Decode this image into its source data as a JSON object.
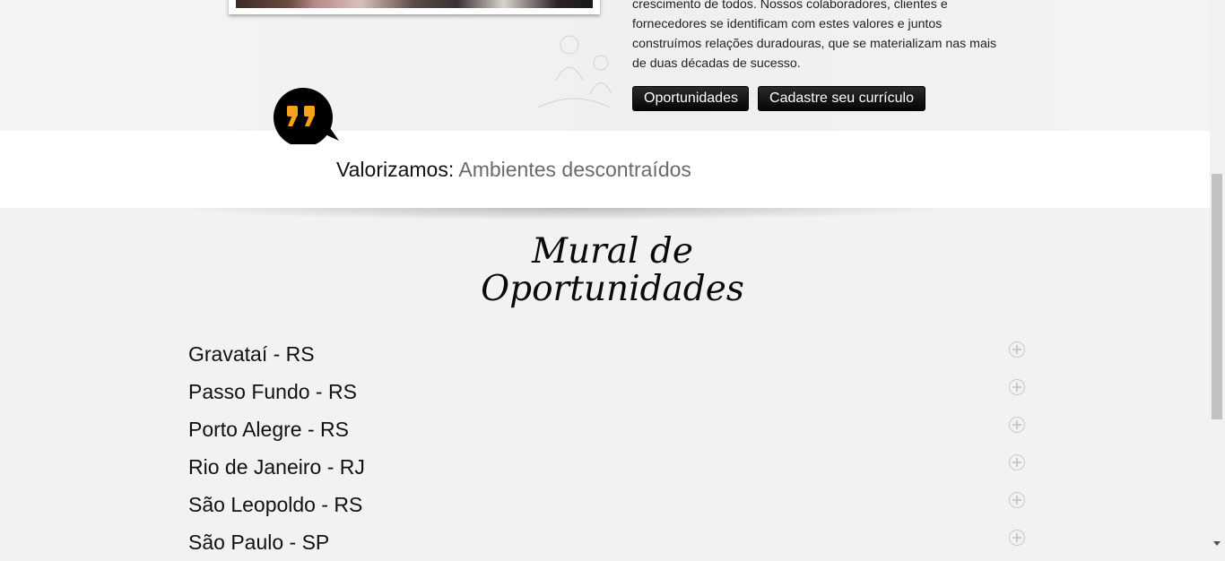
{
  "hero": {
    "intro_lines": [
      "crescimento de todos. Nossos colaboradores, clientes e",
      "fornecedores se identificam com estes valores e juntos",
      "construímos relações duradouras, que se materializam nas mais",
      "de duas décadas de sucesso."
    ],
    "buttons": {
      "opportunities": "Oportunidades",
      "register_cv": "Cadastre seu currículo"
    }
  },
  "values": {
    "icon": "quote-icon",
    "label": "Valorizamos:",
    "value": "Ambientes descontraídos"
  },
  "mural": {
    "title_line1": "Mural de",
    "title_line2": "Oportunidades",
    "cities": [
      {
        "name": "Gravataí - RS",
        "icon": "plus-circle-icon"
      },
      {
        "name": "Passo Fundo - RS",
        "icon": "plus-circle-icon"
      },
      {
        "name": "Porto Alegre - RS",
        "icon": "plus-circle-icon"
      },
      {
        "name": "Rio de Janeiro - RJ",
        "icon": "plus-circle-icon"
      },
      {
        "name": "São Leopoldo - RS",
        "icon": "plus-circle-icon"
      },
      {
        "name": "São Paulo - SP",
        "icon": "plus-circle-icon"
      }
    ]
  },
  "colors": {
    "accent": "#f7a21b",
    "button_bg": "#111111",
    "values_text": "#6a6a6a"
  }
}
